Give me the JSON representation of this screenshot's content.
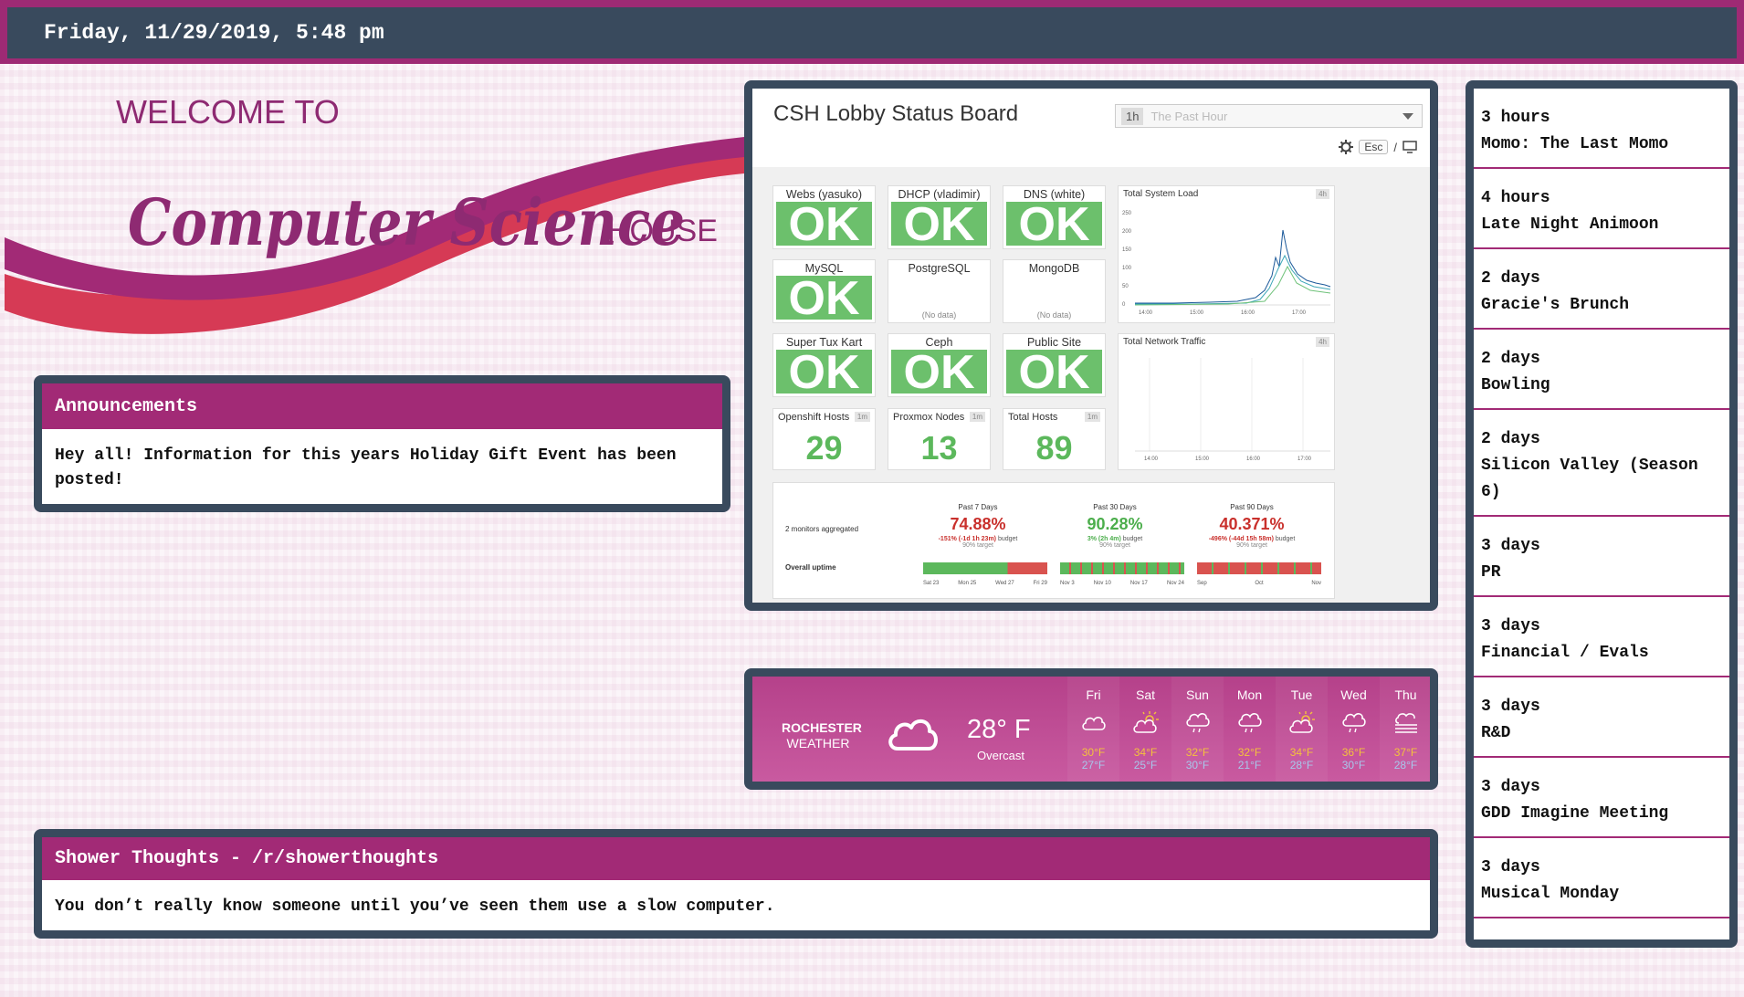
{
  "header": {
    "datetime": "Friday, 11/29/2019, 5:48 pm"
  },
  "logo": {
    "line1": "WELCOME TO",
    "line2": "Computer Science",
    "line3": "HOUSE"
  },
  "announcements": {
    "title": "Announcements",
    "text": "Hey all! Information for this years Holiday Gift Event has been posted!"
  },
  "dashboard": {
    "title": "CSH Lobby Status Board",
    "time_selector": {
      "value": "1h",
      "placeholder": "The Past Hour"
    },
    "esc_key": "Esc",
    "slash": "/",
    "status_checks": [
      {
        "name": "Webs (yasuko)",
        "status": "OK"
      },
      {
        "name": "DHCP (vladimir)",
        "status": "OK"
      },
      {
        "name": "DNS (white)",
        "status": "OK"
      },
      {
        "name": "MySQL",
        "status": "OK"
      },
      {
        "name": "PostgreSQL",
        "status": "(No data)"
      },
      {
        "name": "MongoDB",
        "status": "(No data)"
      },
      {
        "name": "Super Tux Kart",
        "status": "OK"
      },
      {
        "name": "Ceph",
        "status": "OK"
      },
      {
        "name": "Public Site",
        "status": "OK"
      }
    ],
    "metrics": [
      {
        "name": "Openshift Hosts",
        "value": "29",
        "badge": "1m"
      },
      {
        "name": "Proxmox Nodes",
        "value": "13",
        "badge": "1m"
      },
      {
        "name": "Total Hosts",
        "value": "89",
        "badge": "1m"
      }
    ],
    "system_load": {
      "title": "Total System Load",
      "badge": "4h",
      "y_ticks": [
        "250",
        "200",
        "150",
        "100",
        "50",
        "0"
      ],
      "x_ticks": [
        "14:00",
        "15:00",
        "16:00",
        "17:00"
      ]
    },
    "network_traffic": {
      "title": "Total Network Traffic",
      "badge": "4h",
      "x_ticks": [
        "14:00",
        "15:00",
        "16:00",
        "17:00"
      ]
    },
    "uptime": {
      "monitors_label": "2 monitors aggregated",
      "overall_label": "Overall uptime",
      "periods": [
        {
          "header": "Past 7 Days",
          "percent": "74.88%",
          "budget": "-151% (-1d 1h 23m)",
          "budget_word": "budget",
          "target": "90% target",
          "color": "#c9302c",
          "ticks": [
            "Sat 23",
            "Mon 25",
            "Wed 27",
            "Fri 29"
          ]
        },
        {
          "header": "Past 30 Days",
          "percent": "90.28%",
          "budget": "3% (2h 4m)",
          "budget_word": "budget",
          "target": "90% target",
          "color": "#4cae4c",
          "ticks": [
            "Nov 3",
            "Nov 10",
            "Nov 17",
            "Nov 24"
          ]
        },
        {
          "header": "Past 90 Days",
          "percent": "40.371%",
          "budget": "-496% (-44d 15h 58m)",
          "budget_word": "budget",
          "target": "90% target",
          "color": "#c9302c",
          "ticks": [
            "Sep",
            "Oct",
            "Nov"
          ]
        }
      ]
    }
  },
  "weather": {
    "city": "ROCHESTER",
    "label": "WEATHER",
    "current_temp": "28° F",
    "condition": "Overcast",
    "current_icon": "cloud-icon",
    "forecast": [
      {
        "day": "Fri",
        "icon": "cloud-icon",
        "high": "30°F",
        "low": "27°F"
      },
      {
        "day": "Sat",
        "icon": "partly-sunny-icon",
        "high": "34°F",
        "low": "25°F"
      },
      {
        "day": "Sun",
        "icon": "cloud-rain-icon",
        "high": "32°F",
        "low": "30°F"
      },
      {
        "day": "Mon",
        "icon": "cloud-rain-icon",
        "high": "32°F",
        "low": "21°F"
      },
      {
        "day": "Tue",
        "icon": "partly-sunny-icon",
        "high": "34°F",
        "low": "28°F"
      },
      {
        "day": "Wed",
        "icon": "cloud-rain-icon",
        "high": "36°F",
        "low": "30°F"
      },
      {
        "day": "Thu",
        "icon": "fog-icon",
        "high": "37°F",
        "low": "28°F"
      }
    ]
  },
  "shower_thoughts": {
    "title": "Shower Thoughts - /r/showerthoughts",
    "text": "You don’t really know someone until you’ve seen them use a slow computer."
  },
  "schedule": [
    {
      "when": "3 hours",
      "event": "Momo: The Last Momo"
    },
    {
      "when": "4 hours",
      "event": "Late Night Animoon"
    },
    {
      "when": "2 days",
      "event": "Gracie's Brunch"
    },
    {
      "when": "2 days",
      "event": "Bowling"
    },
    {
      "when": "2 days",
      "event": "Silicon Valley (Season 6)"
    },
    {
      "when": "3 days",
      "event": "PR"
    },
    {
      "when": "3 days",
      "event": "Financial / Evals"
    },
    {
      "when": "3 days",
      "event": "R&D"
    },
    {
      "when": "3 days",
      "event": "GDD Imagine Meeting"
    },
    {
      "when": "3 days",
      "event": "Musical Monday"
    }
  ]
}
